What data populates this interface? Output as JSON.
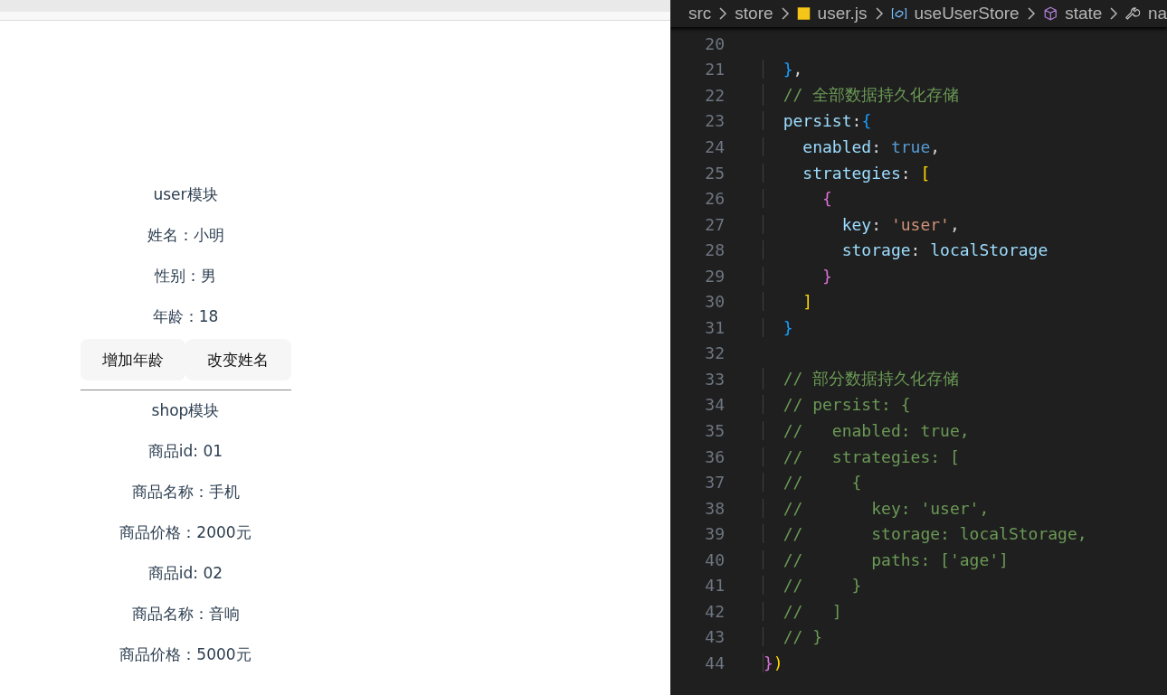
{
  "preview": {
    "sections": [
      {
        "title": "user模块",
        "lines": [
          "姓名：小明",
          "性别：男",
          "年龄：18"
        ],
        "buttons": [
          "增加年龄",
          "改变姓名"
        ]
      },
      {
        "title": "shop模块",
        "lines": [
          "商品id: 01",
          "商品名称：手机",
          "商品价格：2000元",
          "商品id: 02",
          "商品名称：音响",
          "商品价格：5000元"
        ]
      }
    ]
  },
  "editor": {
    "breadcrumb": [
      {
        "kind": "folder",
        "label": "src"
      },
      {
        "kind": "folder",
        "label": "store"
      },
      {
        "kind": "js-file",
        "label": "user.js"
      },
      {
        "kind": "variable",
        "label": "useUserStore"
      },
      {
        "kind": "module",
        "label": "state"
      },
      {
        "kind": "property",
        "label": "na"
      }
    ],
    "lines": [
      {
        "number": "20"
      },
      {
        "number": "21",
        "tokens": [
          {
            "text": "  }",
            "kind": "brace3"
          },
          {
            "text": ",",
            "kind": "punct"
          }
        ]
      },
      {
        "number": "22",
        "tokens": [
          {
            "text": "  // 全部数据持久化存储",
            "kind": "comment"
          }
        ]
      },
      {
        "number": "23",
        "tokens": [
          {
            "text": "  persist",
            "kind": "name"
          },
          {
            "text": ":",
            "kind": "punct"
          },
          {
            "text": "{",
            "kind": "brace3"
          }
        ]
      },
      {
        "number": "24",
        "tokens": [
          {
            "text": "    enabled",
            "kind": "name"
          },
          {
            "text": ": ",
            "kind": "punct"
          },
          {
            "text": "true",
            "kind": "keyword"
          },
          {
            "text": ",",
            "kind": "punct"
          }
        ]
      },
      {
        "number": "25",
        "tokens": [
          {
            "text": "    strategies",
            "kind": "name"
          },
          {
            "text": ": ",
            "kind": "punct"
          },
          {
            "text": "[",
            "kind": "brace1"
          }
        ]
      },
      {
        "number": "26",
        "tokens": [
          {
            "text": "      {",
            "kind": "brace2"
          }
        ]
      },
      {
        "number": "27",
        "tokens": [
          {
            "text": "        key",
            "kind": "name"
          },
          {
            "text": ": ",
            "kind": "punct"
          },
          {
            "text": "'user'",
            "kind": "string"
          },
          {
            "text": ",",
            "kind": "punct"
          }
        ]
      },
      {
        "number": "28",
        "tokens": [
          {
            "text": "        storage",
            "kind": "name"
          },
          {
            "text": ": ",
            "kind": "punct"
          },
          {
            "text": "localStorage",
            "kind": "name"
          }
        ]
      },
      {
        "number": "29",
        "tokens": [
          {
            "text": "      }",
            "kind": "brace2"
          }
        ]
      },
      {
        "number": "30",
        "tokens": [
          {
            "text": "    ]",
            "kind": "brace1"
          }
        ]
      },
      {
        "number": "31",
        "tokens": [
          {
            "text": "  }",
            "kind": "brace3"
          }
        ]
      },
      {
        "number": "32"
      },
      {
        "number": "33",
        "tokens": [
          {
            "text": "  // 部分数据持久化存储",
            "kind": "comment"
          }
        ]
      },
      {
        "number": "34",
        "tokens": [
          {
            "text": "  // persist: {",
            "kind": "comment"
          }
        ]
      },
      {
        "number": "35",
        "tokens": [
          {
            "text": "  //   enabled: true,",
            "kind": "comment"
          }
        ]
      },
      {
        "number": "36",
        "tokens": [
          {
            "text": "  //   strategies: [",
            "kind": "comment"
          }
        ]
      },
      {
        "number": "37",
        "tokens": [
          {
            "text": "  //     {",
            "kind": "comment"
          }
        ]
      },
      {
        "number": "38",
        "tokens": [
          {
            "text": "  //       key: 'user',",
            "kind": "comment"
          }
        ]
      },
      {
        "number": "39",
        "tokens": [
          {
            "text": "  //       storage: localStorage,",
            "kind": "comment"
          }
        ]
      },
      {
        "number": "40",
        "tokens": [
          {
            "text": "  //       paths: ['age']",
            "kind": "comment"
          }
        ]
      },
      {
        "number": "41",
        "tokens": [
          {
            "text": "  //     }",
            "kind": "comment"
          }
        ]
      },
      {
        "number": "42",
        "tokens": [
          {
            "text": "  //   ]",
            "kind": "comment"
          }
        ]
      },
      {
        "number": "43",
        "tokens": [
          {
            "text": "  // }",
            "kind": "comment"
          }
        ]
      },
      {
        "number": "44",
        "tokens": [
          {
            "text": "}",
            "kind": "brace2"
          },
          {
            "text": ")",
            "kind": "brace1"
          }
        ]
      }
    ]
  }
}
